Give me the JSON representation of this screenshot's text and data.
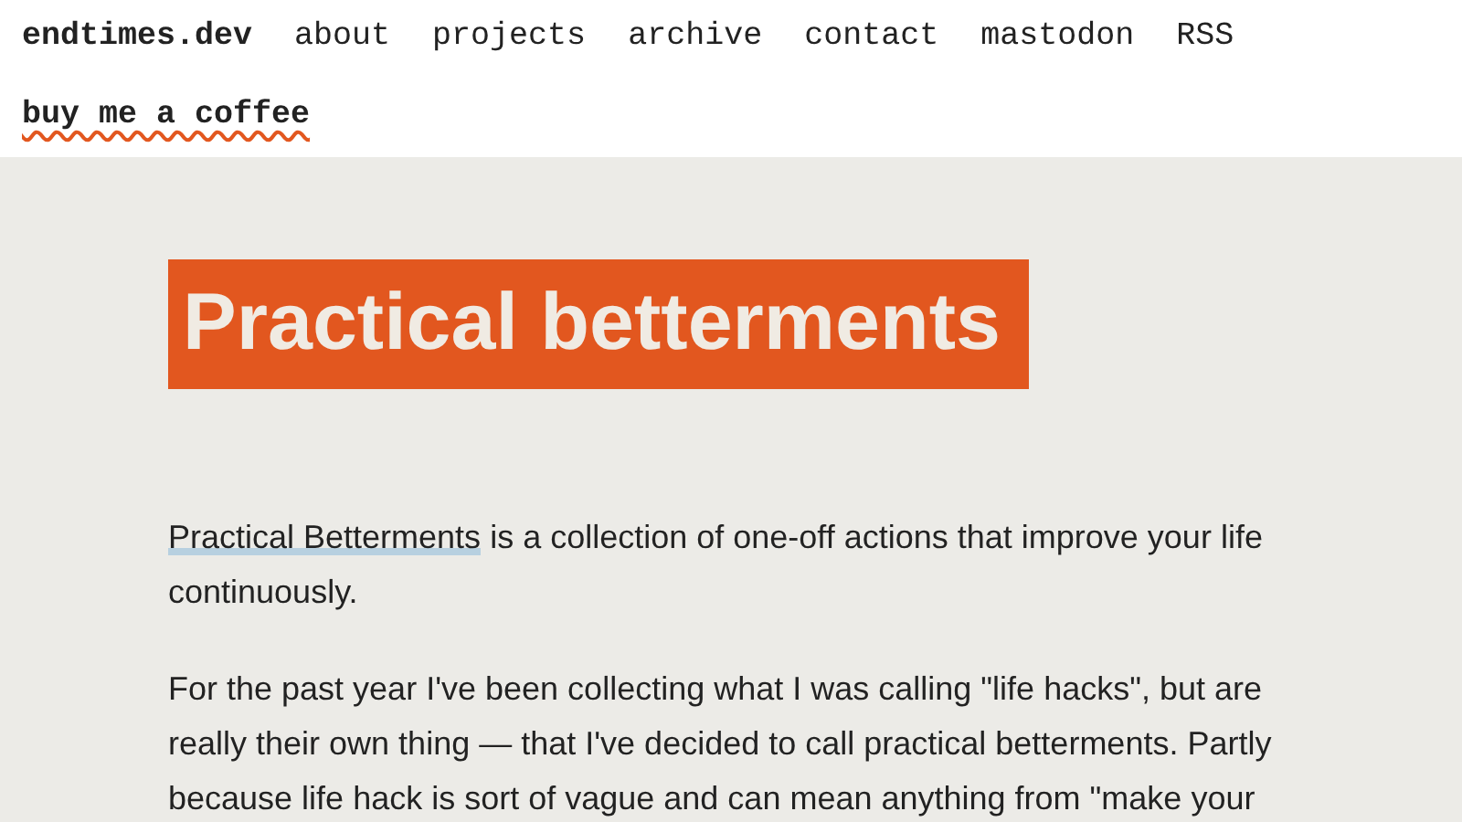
{
  "site": {
    "name": "endtimes.dev",
    "nav": [
      "about",
      "projects",
      "archive",
      "contact",
      "mastodon",
      "RSS"
    ],
    "coffee_link": "buy me a coffee"
  },
  "article": {
    "title": "Practical betterments",
    "intro": {
      "link": "Practical Betterments",
      "rest": " is a collection of one-off actions that improve your life continuously."
    },
    "paragraphs": [
      "For the past year I've been collecting what I was calling \"life hacks\", but are really their own thing — that I've decided to call practical betterments. Partly because life hack is sort of vague and can mean anything from \"make your"
    ]
  }
}
